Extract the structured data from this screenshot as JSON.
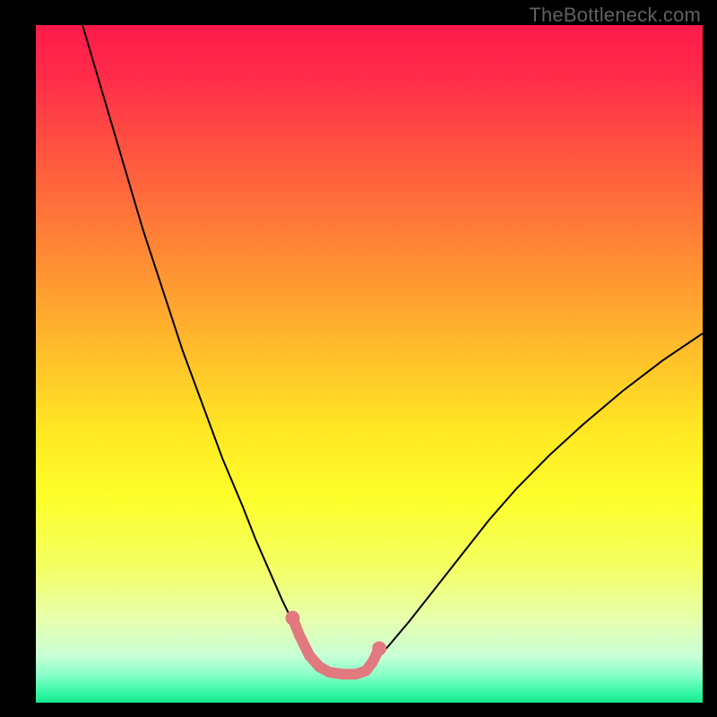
{
  "watermark": "TheBottleneck.com",
  "chart_data": {
    "type": "line",
    "title": "",
    "xlabel": "",
    "ylabel": "",
    "xlim": [
      0,
      100
    ],
    "ylim": [
      0,
      100
    ],
    "background_gradient_stops": [
      {
        "offset": 0.0,
        "color": "#ff1a4a"
      },
      {
        "offset": 0.08,
        "color": "#ff2d49"
      },
      {
        "offset": 0.2,
        "color": "#ff593f"
      },
      {
        "offset": 0.34,
        "color": "#ff8a34"
      },
      {
        "offset": 0.48,
        "color": "#ffbd2b"
      },
      {
        "offset": 0.6,
        "color": "#ffe823"
      },
      {
        "offset": 0.7,
        "color": "#fdff2b"
      },
      {
        "offset": 0.8,
        "color": "#f4ff63"
      },
      {
        "offset": 0.88,
        "color": "#e6ffb0"
      },
      {
        "offset": 0.93,
        "color": "#c9ffd6"
      },
      {
        "offset": 0.96,
        "color": "#86ffc8"
      },
      {
        "offset": 0.985,
        "color": "#34f7a4"
      },
      {
        "offset": 1.0,
        "color": "#17e98e"
      }
    ],
    "series": [
      {
        "name": "bottleneck-curve",
        "stroke": "#000000",
        "stroke_width": 2,
        "x": [
          7,
          10,
          13,
          16,
          19,
          22,
          25,
          28,
          31,
          33,
          35,
          37,
          39,
          40.5,
          42,
          44,
          46,
          48,
          49.5,
          51,
          53,
          56,
          60,
          64,
          68,
          72,
          77,
          82,
          88,
          94,
          100
        ],
        "y": [
          100,
          90,
          80,
          70,
          61,
          52,
          44,
          36,
          29,
          24,
          19.5,
          15,
          11,
          8.5,
          6.5,
          5,
          4.3,
          4.3,
          5,
          6.3,
          8.5,
          12,
          17,
          22,
          27,
          31.5,
          36.5,
          41,
          46,
          50.5,
          54.5
        ]
      },
      {
        "name": "highlight-trough",
        "stroke": "#e17a7f",
        "stroke_width": 12,
        "linecap": "round",
        "x": [
          38.5,
          39.5,
          41,
          42.5,
          44,
          46,
          48,
          49.5,
          50.5,
          51.5
        ],
        "y": [
          12.5,
          10,
          7,
          5.3,
          4.5,
          4.2,
          4.2,
          4.7,
          6,
          8
        ]
      }
    ],
    "points": [
      {
        "name": "left-end-dot",
        "x": 38.5,
        "y": 12.5,
        "r": 8,
        "color": "#e17a7f"
      },
      {
        "name": "right-end-dot",
        "x": 51.5,
        "y": 8.0,
        "r": 8,
        "color": "#e17a7f"
      },
      {
        "name": "left-mid-dot",
        "x": 41.0,
        "y": 7.0,
        "r": 6,
        "color": "#e17a7f"
      }
    ]
  }
}
